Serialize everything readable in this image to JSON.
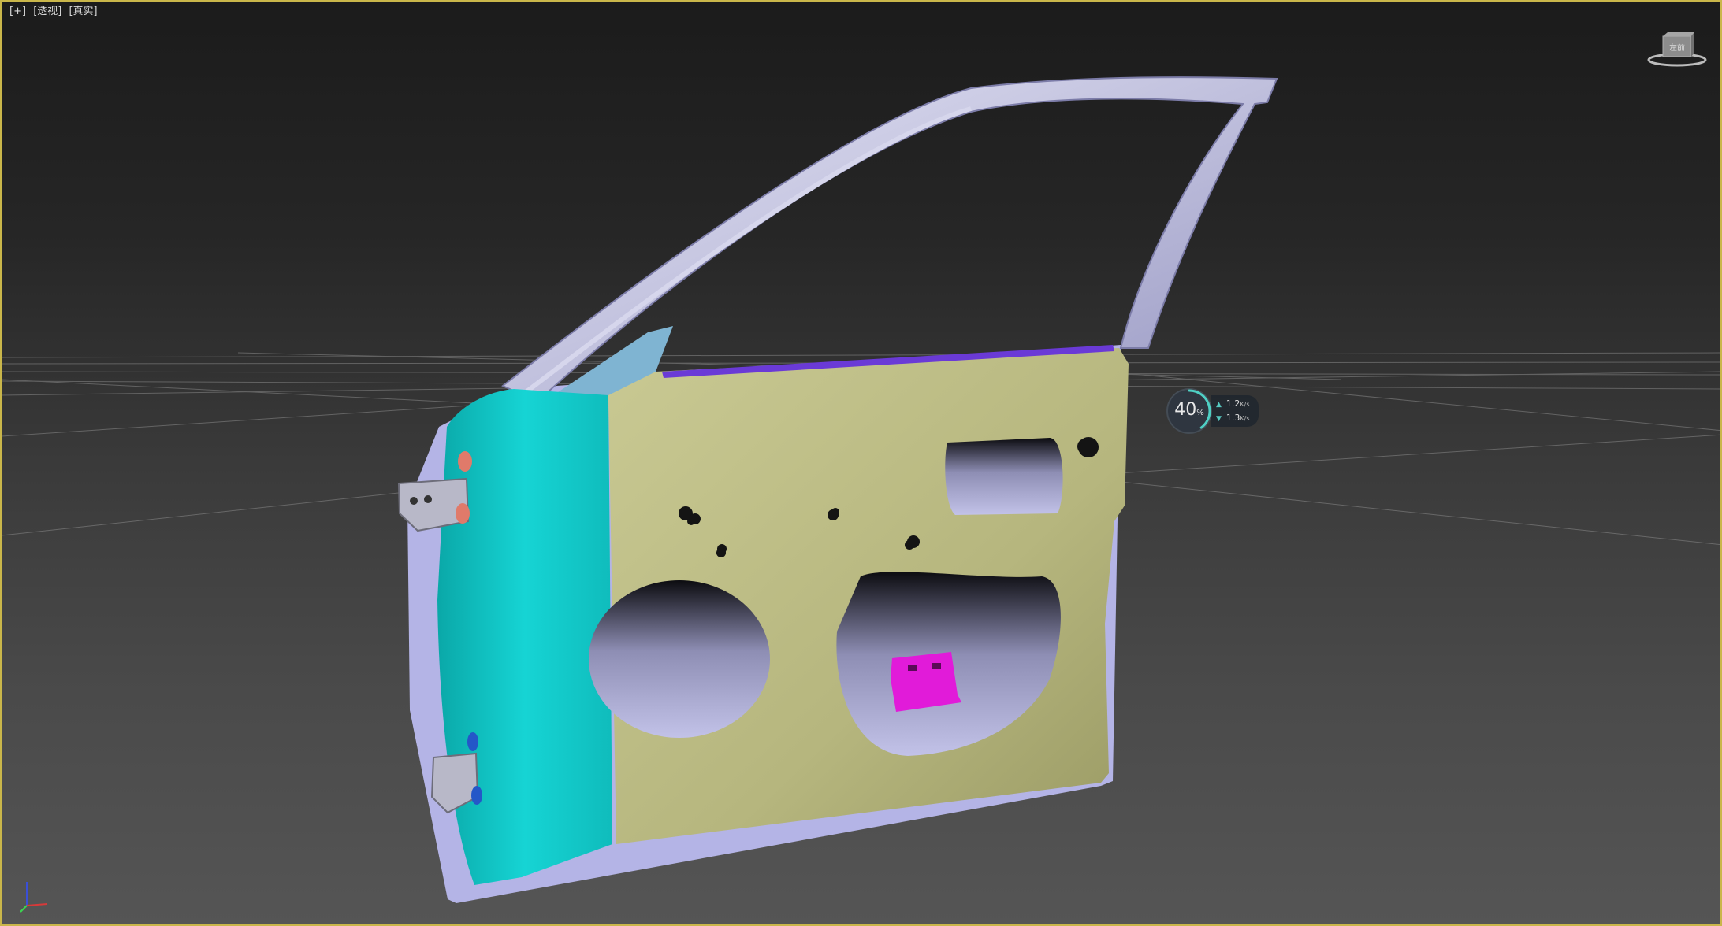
{
  "viewport": {
    "label_plus": "[+]",
    "label_view": "[透视]",
    "label_shading": "[真实]"
  },
  "viewcube": {
    "face_label": "左前",
    "icon": "viewcube-icon"
  },
  "performance": {
    "percent": "40",
    "percent_unit": "%",
    "upload_rate": "1.2",
    "download_rate": "1.3",
    "rate_unit": "K/s",
    "level": 0.4
  },
  "colors": {
    "frame_border": "#c9b64a",
    "inner_panel": "#bdbd87",
    "hinge_reinforcement": "#14c8c8",
    "outer_skin": "#b4b4e6",
    "bracket": "#e11bd9",
    "window_frame": "#c6c6e8"
  },
  "scene_objects": [
    "car-door-model",
    "grid-plane",
    "axis-tripod-icon"
  ]
}
